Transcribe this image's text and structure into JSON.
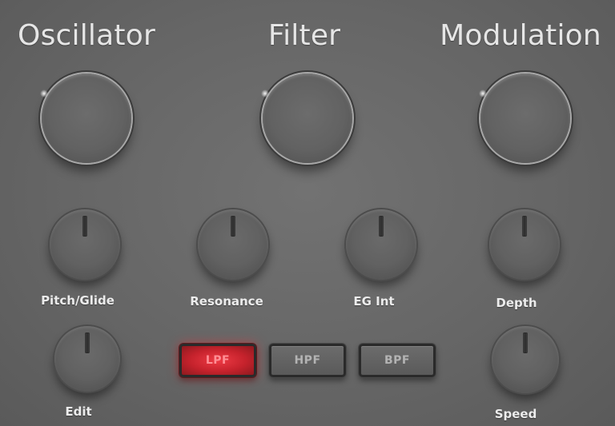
{
  "sections": {
    "oscillator": "Oscillator",
    "filter": "Filter",
    "modulation": "Modulation"
  },
  "knobs": {
    "pitch_glide": "Pitch/Glide",
    "resonance": "Resonance",
    "eg_int": "EG Int",
    "depth": "Depth",
    "edit": "Edit",
    "speed": "Speed"
  },
  "filter_buttons": {
    "lpf": "LPF",
    "hpf": "HPF",
    "bpf": "BPF",
    "active": "LPF"
  },
  "colors": {
    "panel": "#666666",
    "text": "#e6e6e6",
    "active_led": "#e8323c"
  }
}
